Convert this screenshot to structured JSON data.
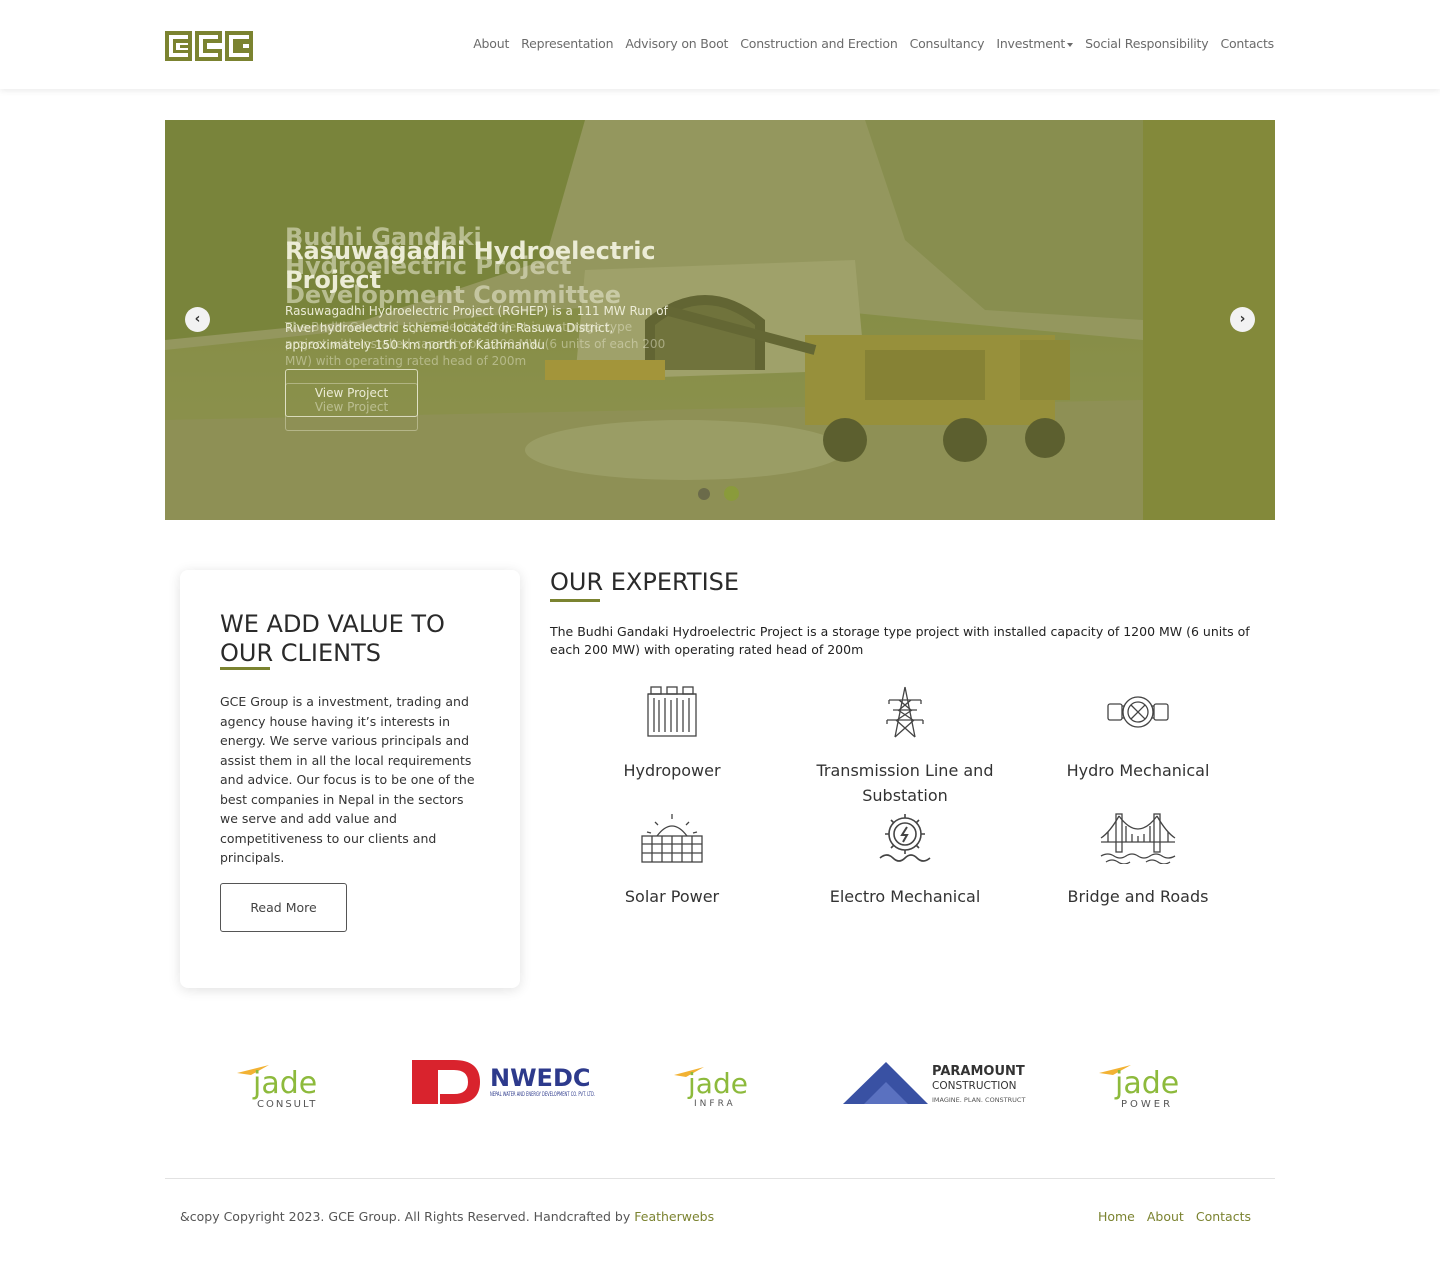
{
  "brand": {
    "logo_text": "GCE",
    "accent_color": "#7b8330"
  },
  "nav": {
    "items": [
      "About",
      "Representation",
      "Advisory on Boot",
      "Construction and Erection",
      "Consultancy",
      "Investment",
      "Social Responsibility",
      "Contacts"
    ]
  },
  "hero": {
    "prev_icon": "chevron-left-icon",
    "next_icon": "chevron-right-icon",
    "title_back": "Budhi Gandaki Hydroelectric Project Development Committee",
    "title": "Rasuwagadhi Hydroelectric Project",
    "desc_back": "The Budhi Gandaki Hydroelectric Project is a storage type project with installed capacity of 1200 MW (6 units of each 200 MW) with operating rated head of 200m",
    "desc": "Rasuwagadhi Hydroelectric Project (RGHEP) is a 111 MW Run of River hydroelectric scheme located in Rasuwa District, approximately 150 km north of Kathmandu",
    "button_label": "View Project",
    "button_label_back": "View Project",
    "slides": 2,
    "active_slide": 2
  },
  "value_card": {
    "title": "WE ADD VALUE TO OUR CLIENTS",
    "body": "GCE Group is a investment, trading and agency house having it’s interests in energy. We serve various principals and assist them in all the local requirements and advice. Our focus is to be one of the best companies in Nepal in the sectors we serve and add value and competitiveness to our clients and principals.",
    "button_label": "Read More"
  },
  "expertise": {
    "title": "OUR EXPERTISE",
    "description": "The Budhi Gandaki Hydroelectric Project is a storage type project with installed capacity of 1200 MW (6 units of each 200 MW) with operating rated head of 200m",
    "items": [
      {
        "label": "Hydropower",
        "icon": "dam-icon"
      },
      {
        "label": "Transmission Line and Substation",
        "icon": "transmission-tower-icon"
      },
      {
        "label": "Hydro Mechanical",
        "icon": "pipe-valve-icon"
      },
      {
        "label": "Solar Power",
        "icon": "solar-panel-icon"
      },
      {
        "label": "Electro Mechanical",
        "icon": "turbine-gear-icon"
      },
      {
        "label": "Bridge and Roads",
        "icon": "bridge-icon"
      }
    ]
  },
  "partners": [
    {
      "name": "jade",
      "subtitle": "CONSULT"
    },
    {
      "name": "NWEDC",
      "subtitle": "NEPAL WATER AND ENERGY DEVELOPMENT CO. PVT. LTD."
    },
    {
      "name": "jade",
      "subtitle": "INFRA"
    },
    {
      "name": "PARAMOUNT",
      "name2": "CONSTRUCTION",
      "subtitle": "IMAGINE. PLAN. CONSTRUCT"
    },
    {
      "name": "jade",
      "subtitle": "POWER"
    }
  ],
  "footer": {
    "copyright": "&copy Copyright 2023. GCE Group. All Rights Reserved. Handcrafted by ",
    "credit": "Featherwebs",
    "links": [
      "Home",
      "About",
      "Contacts"
    ]
  }
}
